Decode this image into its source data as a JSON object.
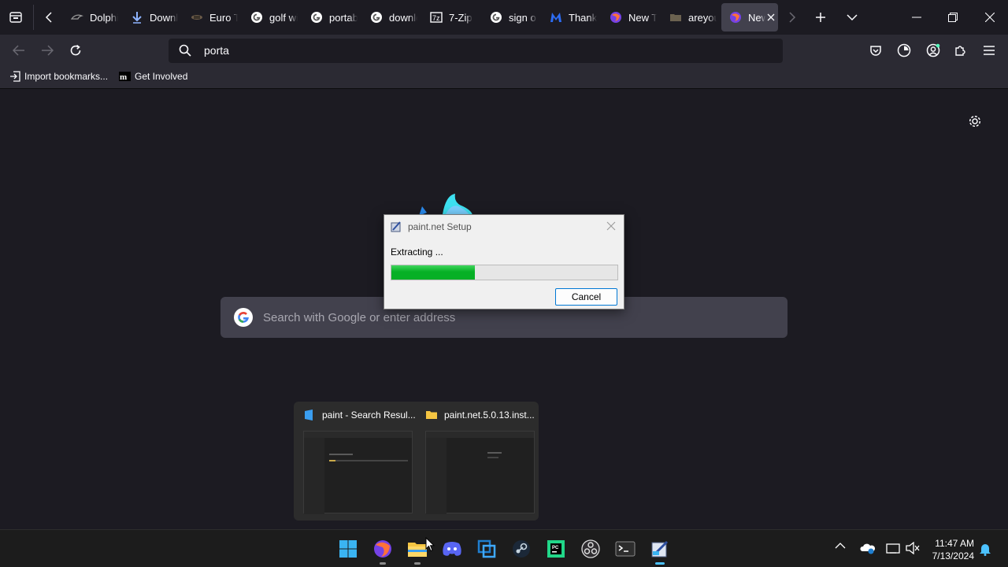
{
  "tabs": [
    {
      "title": "Dolphin",
      "icon": "dolphin-icon"
    },
    {
      "title": "Downloads",
      "icon": "download-icon"
    },
    {
      "title": "Euro Truck",
      "icon": "euro-truck-icon"
    },
    {
      "title": "golf with",
      "icon": "google-icon"
    },
    {
      "title": "portable",
      "icon": "google-icon"
    },
    {
      "title": "download",
      "icon": "google-icon"
    },
    {
      "title": "7-Zip",
      "icon": "7zip-icon"
    },
    {
      "title": "sign on",
      "icon": "google-icon"
    },
    {
      "title": "Thank",
      "icon": "malwarebytes-icon"
    },
    {
      "title": "New Tab",
      "icon": "firefox-icon"
    },
    {
      "title": "areyou",
      "icon": "folder-icon"
    },
    {
      "title": "New",
      "icon": "firefox-icon"
    }
  ],
  "urlbar": {
    "value": "porta"
  },
  "bookmarks": [
    {
      "label": "Import bookmarks...",
      "icon": "import-icon"
    },
    {
      "label": "Get Involved",
      "icon": "mozilla-icon"
    }
  ],
  "newtab": {
    "search_placeholder": "Search with Google or enter address"
  },
  "dialog": {
    "title": "paint.net Setup",
    "message": "Extracting ...",
    "progress": 0.37,
    "cancel_label": "Cancel",
    "progress_color": "#06b025"
  },
  "previews": [
    {
      "title": "paint - Search Resul...",
      "icon": "search-icon"
    },
    {
      "title": "paint.net.5.0.13.inst...",
      "icon": "folder-icon"
    }
  ],
  "taskbar": {
    "apps": [
      "start-icon",
      "firefox-icon",
      "file-explorer-icon",
      "discord-icon",
      "virtualbox-icon",
      "steam-icon",
      "pycharm-icon",
      "obs-icon",
      "terminal-icon",
      "paint-net-icon"
    ],
    "time": "11:47 AM",
    "date": "7/13/2024"
  },
  "colors": {
    "accent": "#0078d4",
    "toolbar": "#2b2a33",
    "background": "#1c1b22"
  }
}
